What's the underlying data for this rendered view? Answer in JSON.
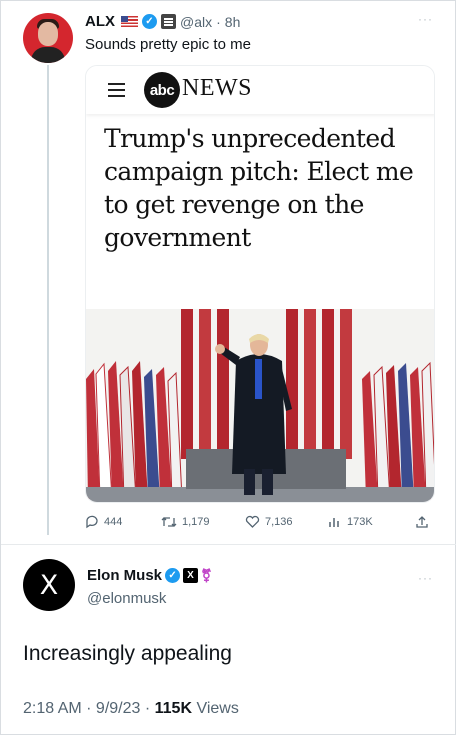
{
  "quoted_tweet": {
    "display_name": "ALX",
    "handle": "@alx",
    "time": "8h",
    "separator": "·",
    "more": "···",
    "text": "Sounds pretty epic to me",
    "card": {
      "publisher_logo_text": "abc",
      "publisher_name": "NEWS",
      "headline": "Trump's unprecedented campaign pitch: Elect me to get revenge on the government"
    },
    "stats": {
      "replies": "444",
      "retweets": "1,179",
      "likes": "7,136",
      "views": "173K"
    }
  },
  "main_tweet": {
    "display_name": "Elon Musk",
    "handle": "@elonmusk",
    "avatar_glyph": "X",
    "x_badge": "X",
    "more": "···",
    "text": "Increasingly appealing",
    "time": "2:18 AM · 9/9/23 · ",
    "views_count": "115K",
    "views_label": " Views"
  },
  "colors": {
    "verified": "#1d9bf0",
    "muted_text": "#536471",
    "alx_avatar_bg": "#d4262e",
    "flag_red": "#b3262e"
  }
}
